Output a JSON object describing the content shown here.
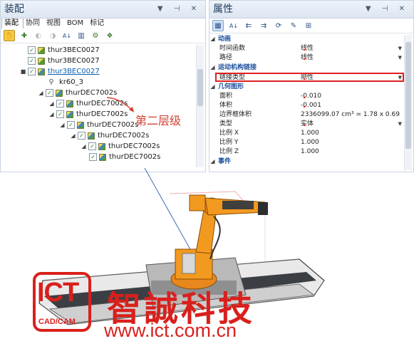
{
  "left_panel": {
    "title": "装配",
    "title_icons": "▼ ⊣ ✕",
    "tabs": [
      {
        "label": "装配",
        "active": true
      },
      {
        "label": "协同",
        "active": false
      },
      {
        "label": "视图",
        "active": false
      },
      {
        "label": "BOM",
        "active": false
      },
      {
        "label": "标记",
        "active": false
      }
    ],
    "tree": [
      {
        "label": "thur3BEC0027",
        "checked": true,
        "link": false
      },
      {
        "label": "thur3BEC0027",
        "checked": true,
        "link": false
      },
      {
        "label": "thur3BEC0027",
        "checked": true,
        "link": true
      },
      {
        "label": "kr60_3",
        "checked": false,
        "link": false
      },
      {
        "label": "thurDEC7002s",
        "checked": true,
        "link": false
      },
      {
        "label": "thurDEC7002s",
        "checked": true,
        "link": false
      },
      {
        "label": "thurDEC7002s",
        "checked": true,
        "link": false
      },
      {
        "label": "thurDEC7002s",
        "checked": true,
        "link": false
      },
      {
        "label": "thurDEC7002s",
        "checked": true,
        "link": false
      },
      {
        "label": "thurDEC7002s",
        "checked": true,
        "link": false
      },
      {
        "label": "thurDEC7002s",
        "checked": true,
        "link": false
      }
    ]
  },
  "right_panel": {
    "title": "属性",
    "title_icons": "▼ ⊣ ✕",
    "sections": {
      "animation": "动画",
      "joint": "运动机构链接",
      "geometry": "几何图形",
      "events": "事件"
    },
    "rows": {
      "time_func": {
        "name": "时间函数",
        "value": "线性"
      },
      "path": {
        "name": "路径",
        "value": "线性"
      },
      "link_type": {
        "name": "链接类型",
        "value": "刚性"
      },
      "area": {
        "name": "面积",
        "value": "-0.010"
      },
      "volume": {
        "name": "体积",
        "value": "-0.001"
      },
      "bbox_volume": {
        "name": "边界框体积",
        "value": "2336099.07 cm³ = 1.78 x 0.69"
      },
      "type": {
        "name": "类型",
        "value": "实体"
      },
      "scale_x": {
        "name": "比例 X",
        "value": "1.000"
      },
      "scale_y": {
        "name": "比例 Y",
        "value": "1.000"
      },
      "scale_z": {
        "name": "比例 Z",
        "value": "1.000"
      }
    }
  },
  "annotation": "第二层级",
  "watermark": {
    "logo": "ICT",
    "logo_sub": "CAD/CAM",
    "company": "智誠科技",
    "url": "www.ict.com.cn"
  },
  "colors": {
    "highlight": "#e02020",
    "annotation": "#d44030",
    "robot": "#f29a1f",
    "watermark": "#d9201c"
  }
}
